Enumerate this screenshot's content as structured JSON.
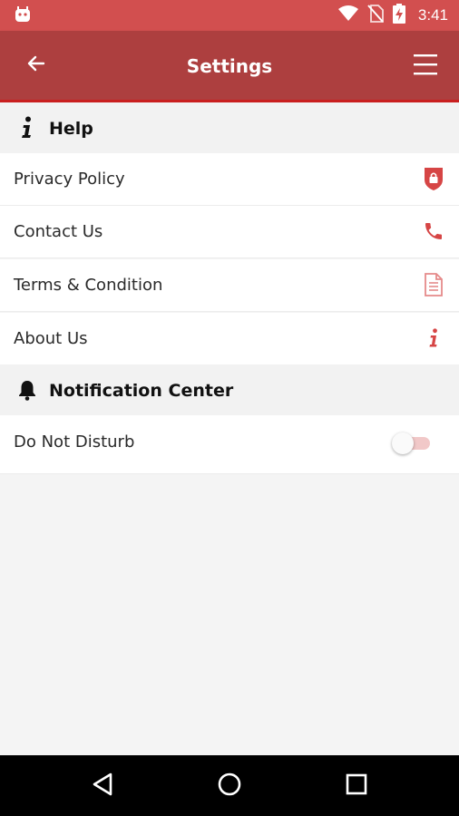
{
  "status_bar": {
    "time": "3:41"
  },
  "app_bar": {
    "title": "Settings"
  },
  "help_section": {
    "title": "Help",
    "items": [
      {
        "label": "Privacy Policy",
        "icon": "shield-lock-icon"
      },
      {
        "label": "Contact Us",
        "icon": "phone-icon"
      },
      {
        "label": "Terms & Condition",
        "icon": "document-icon"
      },
      {
        "label": "About Us",
        "icon": "info-icon"
      }
    ]
  },
  "notification_section": {
    "title": "Notification Center",
    "items": [
      {
        "label": "Do Not Disturb",
        "toggle_on": false
      }
    ]
  },
  "colors": {
    "status_bar": "#d24f4f",
    "app_bar": "#ad3f3f",
    "accent": "#d64545",
    "page_bg": "#f4f4f4"
  }
}
